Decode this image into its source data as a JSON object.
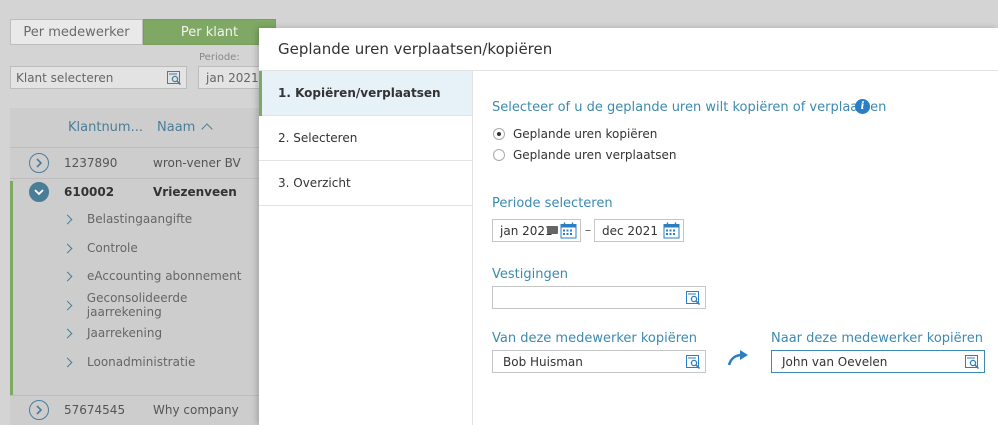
{
  "background": {
    "tabs": [
      {
        "label": "Per medewerker",
        "active": false
      },
      {
        "label": "Per klant",
        "active": true
      }
    ],
    "periode_label": "Periode:",
    "client_select_placeholder": "Klant selecteren",
    "periode_value": "jan 2021",
    "columns": {
      "number": "Klantnum...",
      "name": "Naam"
    },
    "clients": [
      {
        "number": "1237890",
        "name": "wron-vener BV",
        "expanded": false
      },
      {
        "number": "610002",
        "name": "Vriezenveen",
        "expanded": true
      },
      {
        "number": "57674545",
        "name": "Why company",
        "expanded": false
      }
    ],
    "sub_items": [
      "Belastingaangifte",
      "Controle",
      "eAccounting abonnement",
      "Geconsolideerde jaarrekening",
      "Jaarrekening",
      "Loonadministratie"
    ]
  },
  "dialog": {
    "title": "Geplande uren verplaatsen/kopiëren",
    "steps": [
      {
        "label": "1. Kopiëren/verplaatsen",
        "active": true
      },
      {
        "label": "2. Selecteren",
        "active": false
      },
      {
        "label": "3. Overzicht",
        "active": false
      }
    ],
    "choice_label": "Selecteer of u de geplande uren wilt kopiëren of verplaatsen",
    "options": [
      {
        "label": "Geplande uren kopiëren",
        "checked": true
      },
      {
        "label": "Geplande uren verplaatsen",
        "checked": false
      }
    ],
    "period_label": "Periode selecteren",
    "period_from": "jan 2021",
    "period_to": "dec 2021",
    "period_separator": "–",
    "vestigingen_label": "Vestigingen",
    "vestigingen_value": "",
    "from_label": "Van deze medewerker kopiëren",
    "from_value": "Bob Huisman",
    "to_label": "Naar deze medewerker kopiëren",
    "to_value": "John van Oevelen"
  },
  "colors": {
    "accent_green": "#7fa864",
    "link_blue": "#3d8ab0",
    "info_blue": "#2a7fc4",
    "active_step_bg": "#e7f1f8"
  }
}
